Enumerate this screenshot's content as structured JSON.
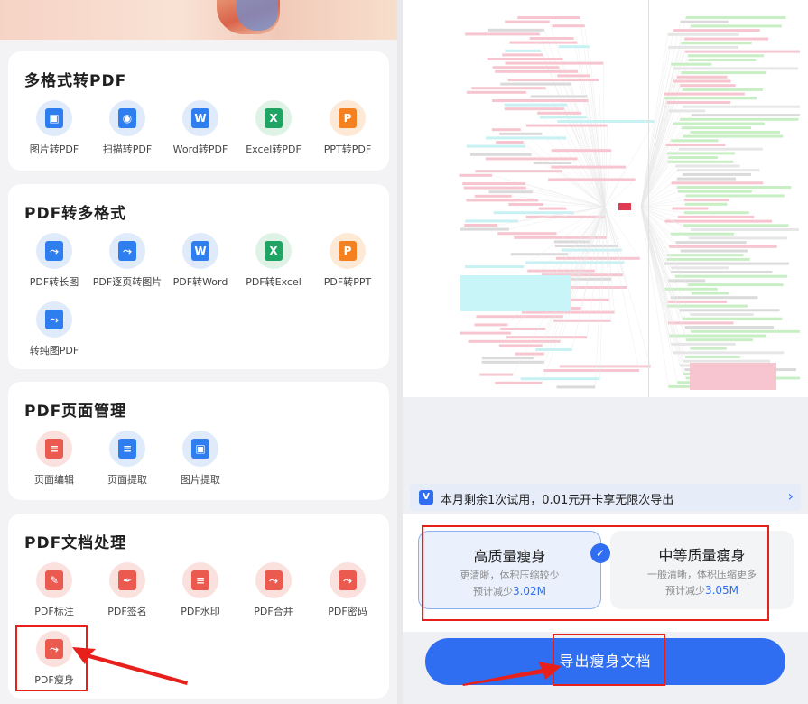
{
  "left": {
    "sections": [
      {
        "title": "多格式转PDF",
        "items": [
          {
            "label": "图片转PDF",
            "icon": "image-to-pdf-icon",
            "color": "blue",
            "mark": "▣"
          },
          {
            "label": "扫描转PDF",
            "icon": "scan-to-pdf-icon",
            "color": "blue",
            "mark": "◉"
          },
          {
            "label": "Word转PDF",
            "icon": "word-to-pdf-icon",
            "color": "blue",
            "mark": "W"
          },
          {
            "label": "Excel转PDF",
            "icon": "excel-to-pdf-icon",
            "color": "green",
            "mark": "X"
          },
          {
            "label": "PPT转PDF",
            "icon": "ppt-to-pdf-icon",
            "color": "orange",
            "mark": "P"
          }
        ]
      },
      {
        "title": "PDF转多格式",
        "items": [
          {
            "label": "PDF转长图",
            "icon": "pdf-to-long-image-icon",
            "color": "blue",
            "mark": "⤳"
          },
          {
            "label": "PDF逐页转图片",
            "icon": "pdf-to-page-images-icon",
            "color": "blue",
            "mark": "⤳"
          },
          {
            "label": "PDF转Word",
            "icon": "pdf-to-word-icon",
            "color": "blue",
            "mark": "W"
          },
          {
            "label": "PDF转Excel",
            "icon": "pdf-to-excel-icon",
            "color": "green",
            "mark": "X"
          },
          {
            "label": "PDF转PPT",
            "icon": "pdf-to-ppt-icon",
            "color": "orange",
            "mark": "P"
          },
          {
            "label": "转纯图PDF",
            "icon": "pure-image-pdf-icon",
            "color": "blue",
            "mark": "⤳"
          }
        ]
      },
      {
        "title": "PDF页面管理",
        "items": [
          {
            "label": "页面编辑",
            "icon": "page-edit-icon",
            "color": "red",
            "mark": "≡"
          },
          {
            "label": "页面提取",
            "icon": "page-extract-icon",
            "color": "blue",
            "mark": "≡"
          },
          {
            "label": "图片提取",
            "icon": "image-extract-icon",
            "color": "blue",
            "mark": "▣"
          }
        ]
      },
      {
        "title": "PDF文档处理",
        "items": [
          {
            "label": "PDF标注",
            "icon": "pdf-annotate-icon",
            "color": "red",
            "mark": "✎"
          },
          {
            "label": "PDF签名",
            "icon": "pdf-sign-icon",
            "color": "red",
            "mark": "✒"
          },
          {
            "label": "PDF水印",
            "icon": "pdf-watermark-icon",
            "color": "red",
            "mark": "≡"
          },
          {
            "label": "PDF合并",
            "icon": "pdf-merge-icon",
            "color": "red",
            "mark": "⤳"
          },
          {
            "label": "PDF密码",
            "icon": "pdf-password-icon",
            "color": "red",
            "mark": "⤳"
          },
          {
            "label": "PDF瘦身",
            "icon": "pdf-slim-icon",
            "color": "red",
            "mark": "⤳"
          }
        ]
      }
    ]
  },
  "right": {
    "trial_text": "本月剩余1次试用，0.01元开卡享无限次导出",
    "vip_icon": "vip-icon",
    "options": [
      {
        "name": "高质量瘦身",
        "desc": "更清晰，体积压缩较少",
        "est_prefix": "预计减少",
        "est_value": "3.02M",
        "selected": true
      },
      {
        "name": "中等质量瘦身",
        "desc": "一般清晰，体积压缩更多",
        "est_prefix": "预计减少",
        "est_value": "3.05M",
        "selected": false
      }
    ],
    "export_label": "导出瘦身文档"
  },
  "colors": {
    "accent": "#2f6ef0",
    "highlight": "#e8201c"
  }
}
